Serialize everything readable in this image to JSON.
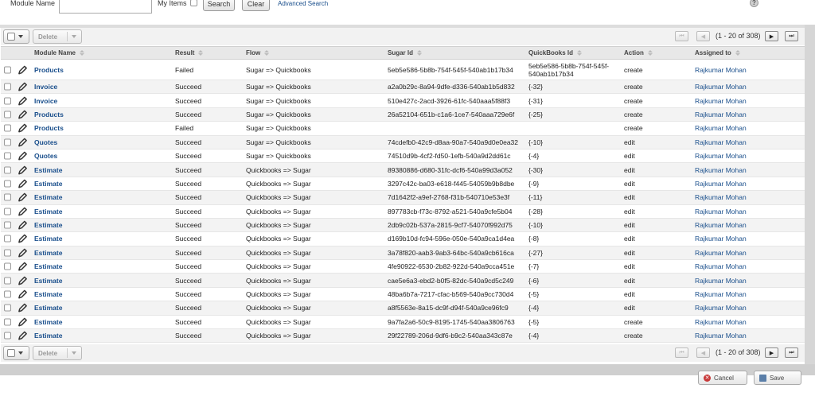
{
  "search": {
    "module_name_label": "Module Name",
    "module_name_value": "",
    "my_items_label": "My Items",
    "search_label": "Search",
    "clear_label": "Clear",
    "advanced_label": "Advanced Search",
    "help_glyph": "?"
  },
  "toolbar": {
    "delete_label": "Delete",
    "page_info": "(1 - 20 of 308)"
  },
  "columns": [
    "Module Name",
    "Result",
    "Flow",
    "Sugar Id",
    "QuickBooks Id",
    "Action",
    "Assigned to"
  ],
  "rows": [
    {
      "module": "Products",
      "result": "Failed",
      "flow": "Sugar => Quickbooks",
      "sugar_id": "5eb5e586-5b8b-754f-545f-540ab1b17b34",
      "qb_id": "5eb5e586-5b8b-754f-545f-",
      "qb_id2": "540ab1b17b34",
      "action": "create",
      "assigned": "Rajkumar Mohan"
    },
    {
      "module": "Invoice",
      "result": "Succeed",
      "flow": "Sugar => Quickbooks",
      "sugar_id": "a2a0b29c-8a94-9dfe-d336-540ab1b5d832",
      "qb_id": "{-32}",
      "action": "create",
      "assigned": "Rajkumar Mohan"
    },
    {
      "module": "Invoice",
      "result": "Succeed",
      "flow": "Sugar => Quickbooks",
      "sugar_id": "510e427c-2acd-3926-61fc-540aaa5f88f3",
      "qb_id": "{-31}",
      "action": "create",
      "assigned": "Rajkumar Mohan"
    },
    {
      "module": "Products",
      "result": "Succeed",
      "flow": "Sugar => Quickbooks",
      "sugar_id": "26a52104-651b-c1a6-1ce7-540aaa729e6f",
      "qb_id": "{-25}",
      "action": "create",
      "assigned": "Rajkumar Mohan"
    },
    {
      "module": "Products",
      "result": "Failed",
      "flow": "Sugar => Quickbooks",
      "sugar_id": "",
      "qb_id": "",
      "action": "create",
      "assigned": "Rajkumar Mohan"
    },
    {
      "module": "Quotes",
      "result": "Succeed",
      "flow": "Sugar => Quickbooks",
      "sugar_id": "74cdefb0-42c9-d8aa-90a7-540a9d0e0ea32",
      "qb_id": "{-10}",
      "action": "edit",
      "assigned": "Rajkumar Mohan"
    },
    {
      "module": "Quotes",
      "result": "Succeed",
      "flow": "Sugar => Quickbooks",
      "sugar_id": "74510d9b-4cf2-fd50-1efb-540a9d2dd61c",
      "qb_id": "{-4}",
      "action": "edit",
      "assigned": "Rajkumar Mohan"
    },
    {
      "module": "Estimate",
      "result": "Succeed",
      "flow": "Quickbooks => Sugar",
      "sugar_id": "89380886-d680-31fc-dcf6-540a99d3a052",
      "qb_id": "{-30}",
      "action": "edit",
      "assigned": "Rajkumar Mohan"
    },
    {
      "module": "Estimate",
      "result": "Succeed",
      "flow": "Quickbooks => Sugar",
      "sugar_id": "3297c42c-ba03-e618-f445-54059b9b8dbe",
      "qb_id": "{-9}",
      "action": "edit",
      "assigned": "Rajkumar Mohan"
    },
    {
      "module": "Estimate",
      "result": "Succeed",
      "flow": "Quickbooks => Sugar",
      "sugar_id": "7d1642f2-a9ef-2768-f31b-540710e53e3f",
      "qb_id": "{-11}",
      "action": "edit",
      "assigned": "Rajkumar Mohan"
    },
    {
      "module": "Estimate",
      "result": "Succeed",
      "flow": "Quickbooks => Sugar",
      "sugar_id": "897783cb-f73c-8792-a521-540a9cfe5b04",
      "qb_id": "{-28}",
      "action": "edit",
      "assigned": "Rajkumar Mohan"
    },
    {
      "module": "Estimate",
      "result": "Succeed",
      "flow": "Quickbooks => Sugar",
      "sugar_id": "2db9c02b-537a-2815-9cf7-54070f992d75",
      "qb_id": "{-10}",
      "action": "edit",
      "assigned": "Rajkumar Mohan"
    },
    {
      "module": "Estimate",
      "result": "Succeed",
      "flow": "Quickbooks => Sugar",
      "sugar_id": "d169b10d-fc94-596e-050e-540a9ca1d4ea",
      "qb_id": "{-8}",
      "action": "edit",
      "assigned": "Rajkumar Mohan"
    },
    {
      "module": "Estimate",
      "result": "Succeed",
      "flow": "Quickbooks => Sugar",
      "sugar_id": "3a78f820-aab3-9ab3-64bc-540a9cb616ca",
      "qb_id": "{-27}",
      "action": "edit",
      "assigned": "Rajkumar Mohan"
    },
    {
      "module": "Estimate",
      "result": "Succeed",
      "flow": "Quickbooks => Sugar",
      "sugar_id": "4fe90922-6530-2b82-922d-540a9cca451e",
      "qb_id": "{-7}",
      "action": "edit",
      "assigned": "Rajkumar Mohan"
    },
    {
      "module": "Estimate",
      "result": "Succeed",
      "flow": "Quickbooks => Sugar",
      "sugar_id": "cae5e6a3-ebd2-b0f5-82dc-540a9cd5c249",
      "qb_id": "{-6}",
      "action": "edit",
      "assigned": "Rajkumar Mohan"
    },
    {
      "module": "Estimate",
      "result": "Succeed",
      "flow": "Quickbooks => Sugar",
      "sugar_id": "48ba6b7a-7217-cfac-b569-540a9cc730d4",
      "qb_id": "{-5}",
      "action": "edit",
      "assigned": "Rajkumar Mohan"
    },
    {
      "module": "Estimate",
      "result": "Succeed",
      "flow": "Quickbooks => Sugar",
      "sugar_id": "a8f5563e-8a15-dc9f-d94f-540a9ce96fc9",
      "qb_id": "{-4}",
      "action": "edit",
      "assigned": "Rajkumar Mohan"
    },
    {
      "module": "Estimate",
      "result": "Succeed",
      "flow": "Quickbooks => Sugar",
      "sugar_id": "9a7fa2a6-50c9-8195-1745-540aa3806763",
      "qb_id": "{-5}",
      "action": "create",
      "assigned": "Rajkumar Mohan"
    },
    {
      "module": "Estimate",
      "result": "Succeed",
      "flow": "Quickbooks => Sugar",
      "sugar_id": "29f22789-206d-9df6-b9c2-540aa343c87e",
      "qb_id": "{-4}",
      "action": "create",
      "assigned": "Rajkumar Mohan"
    }
  ],
  "footer": {
    "cancel_label": "Cancel",
    "save_label": "Save"
  },
  "colors": {
    "link": "#1a4f8c",
    "header_bg": "#e8e8e8",
    "row_alt": "#f3f3f3"
  }
}
